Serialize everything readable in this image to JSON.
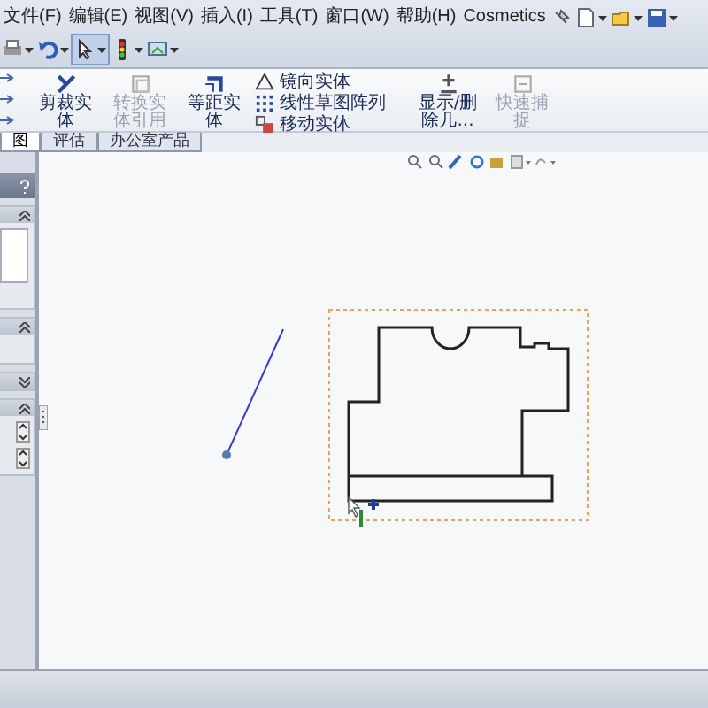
{
  "menu_bar": {
    "items": [
      "文件(F)",
      "编辑(E)",
      "视图(V)",
      "插入(I)",
      "工具(T)",
      "窗口(W)",
      "帮助(H)",
      "Cosmetics"
    ]
  },
  "ribbon": {
    "large_buttons": [
      {
        "label": "剪裁实体",
        "disabled": false
      },
      {
        "label": "转换实体引用",
        "disabled": true
      },
      {
        "label": "等距实体",
        "disabled": false
      }
    ],
    "small_buttons": [
      {
        "label": "镜向实体",
        "disabled": false
      },
      {
        "label": "线性草图阵列",
        "disabled": false
      },
      {
        "label": "移动实体",
        "disabled": false
      }
    ],
    "right_buttons": [
      {
        "label": "显示/删除几...",
        "disabled": false
      },
      {
        "label": "快速捕捉",
        "disabled": true
      }
    ]
  },
  "tabs": [
    {
      "label": "图",
      "selected": true
    },
    {
      "label": "评估",
      "selected": false
    },
    {
      "label": "办公室产品",
      "selected": false
    }
  ],
  "property_panel": {
    "sections": [
      {
        "expanded": true,
        "kind": "list"
      },
      {
        "expanded": true,
        "kind": "blank"
      },
      {
        "expanded": false
      },
      {
        "expanded": true,
        "kind": "spinners"
      }
    ]
  }
}
